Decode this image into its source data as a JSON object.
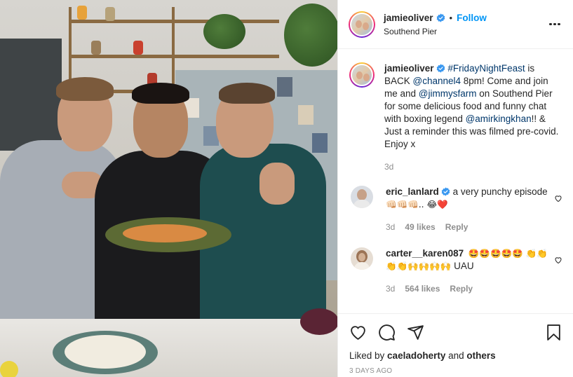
{
  "photo": {
    "alt": ""
  },
  "header": {
    "username": "jamieoliver",
    "separator": "•",
    "follow_label": "Follow",
    "location": "Southend Pier",
    "more_icon": "more-horizontal-icon"
  },
  "caption": {
    "username": "jamieoliver",
    "hashtag": "#FridayNightFeast",
    "text_1": " is BACK ",
    "mention_1": "@channel4",
    "text_2": " 8pm! Come and join me and ",
    "mention_2": "@jimmysfarm",
    "text_3": " on Southend Pier for some delicious food and funny chat with boxing legend ",
    "mention_3": "@amirkingkhan",
    "text_4": "!! & Just a reminder this was filmed pre-covid. Enjoy x",
    "time": "3d"
  },
  "comments": [
    {
      "username": "eric_lanlard",
      "text": "a very punchy episode ",
      "emoji": "👊🏻👊🏻👊🏻.. 😂❤️",
      "time": "3d",
      "likes": "49 likes",
      "reply": "Reply"
    },
    {
      "username": "carter__karen087",
      "text": "",
      "emoji": "🤩🤩🤩🤩🤩 👏👏👏👏🙌🙌🙌🙌",
      "text_after": " UAU",
      "time": "3d",
      "likes": "564 likes",
      "reply": "Reply"
    }
  ],
  "actions": {
    "liked_prefix": "Liked by ",
    "liked_user": "caeladoherty",
    "liked_mid": " and ",
    "liked_others": "others",
    "date": "3 DAYS AGO"
  },
  "colors": {
    "link": "#00376b",
    "follow": "#0095f6",
    "verified": "#3897f0",
    "muted": "#8e8e8e"
  }
}
